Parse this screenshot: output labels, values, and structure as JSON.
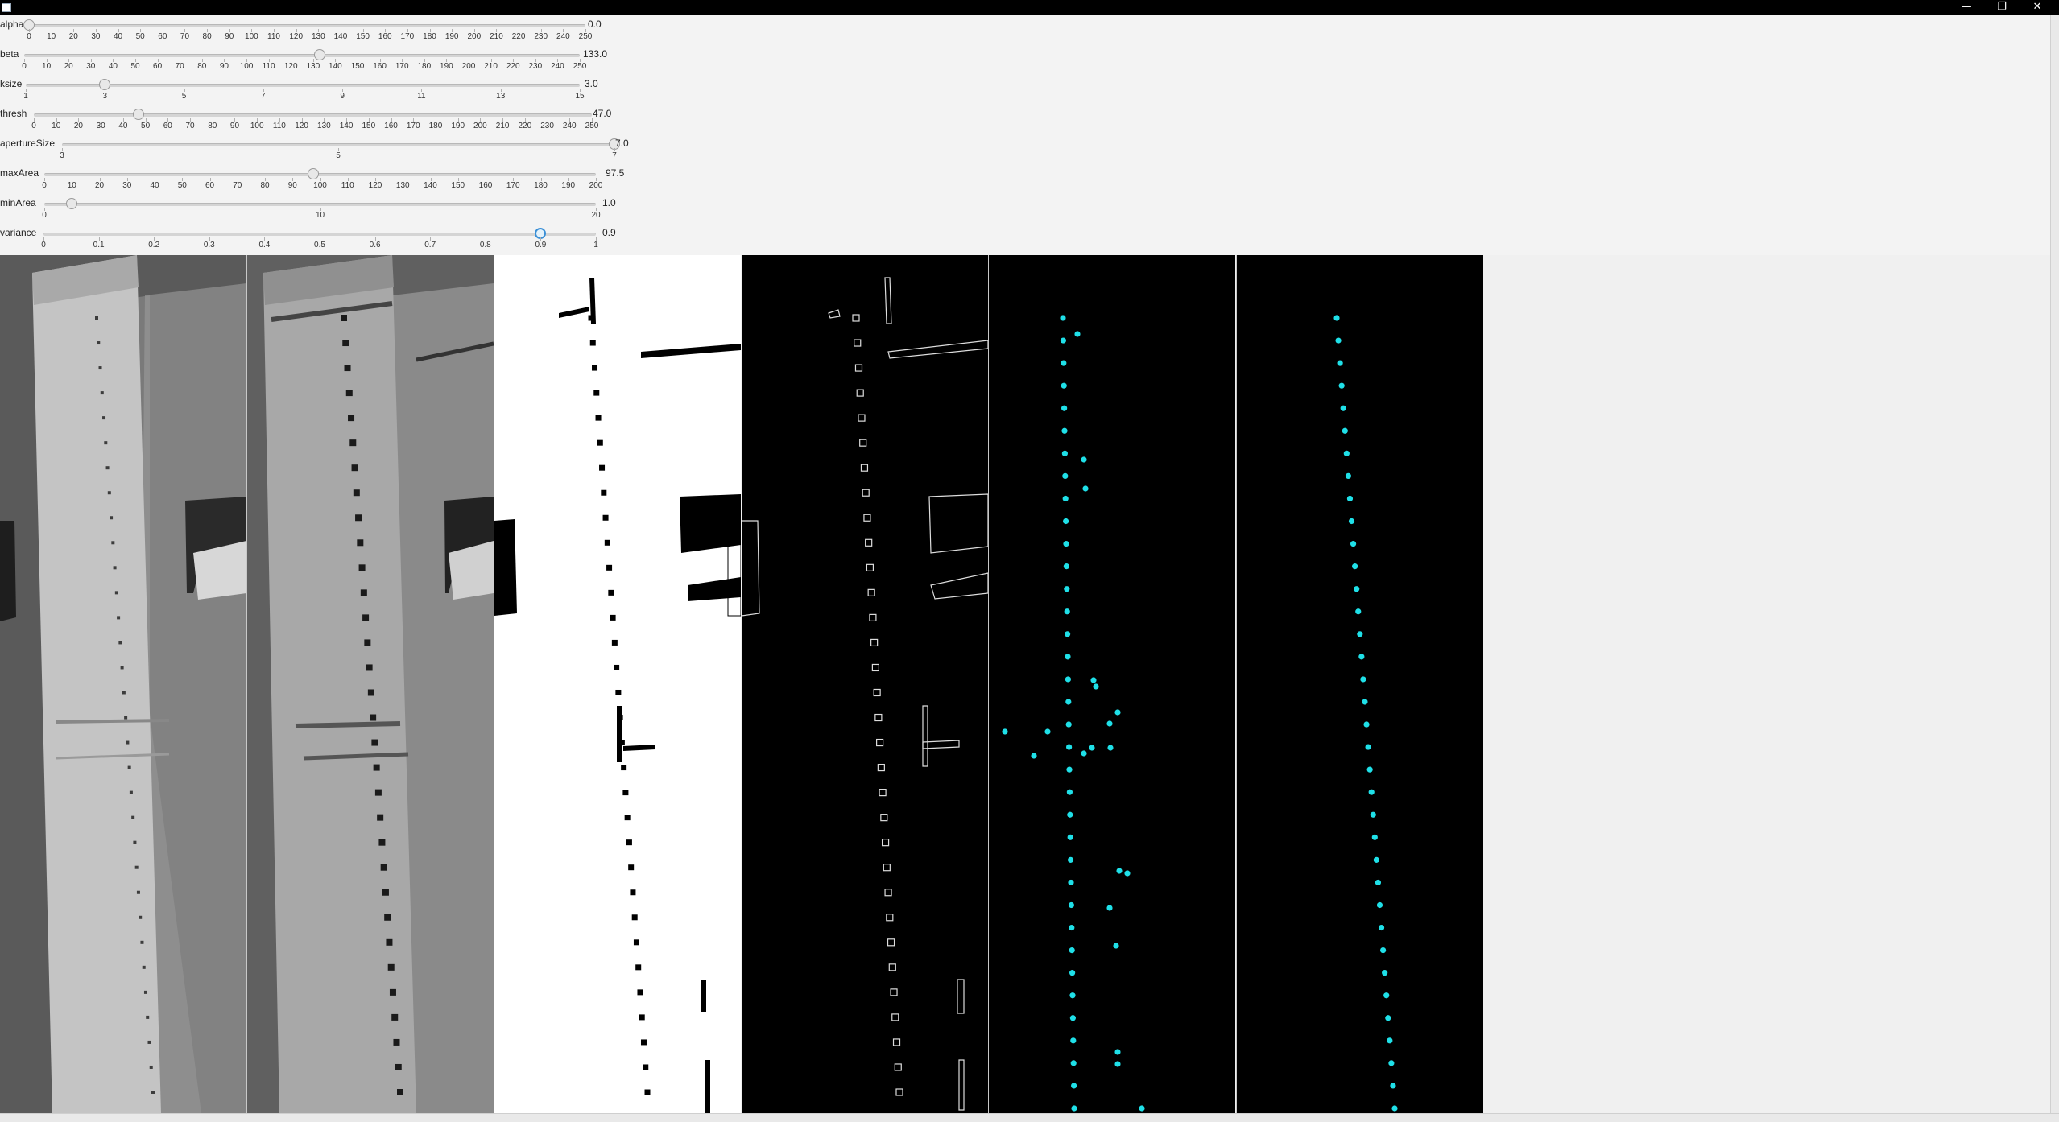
{
  "window": {
    "minimize_glyph": "—",
    "restore_glyph": "❐",
    "close_glyph": "✕"
  },
  "sliders": [
    {
      "id": "alpha",
      "label": "alpha",
      "value_text": "0.0",
      "min": 0,
      "max": 250,
      "value": 0,
      "tick_labels": [
        "0",
        "10",
        "20",
        "30",
        "40",
        "50",
        "60",
        "70",
        "80",
        "90",
        "100",
        "110",
        "120",
        "130",
        "140",
        "150",
        "160",
        "170",
        "180",
        "190",
        "200",
        "210",
        "220",
        "230",
        "240",
        "250"
      ]
    },
    {
      "id": "beta",
      "label": "beta",
      "value_text": "133.0",
      "min": 0,
      "max": 250,
      "value": 133,
      "tick_labels": [
        "0",
        "10",
        "20",
        "30",
        "40",
        "50",
        "60",
        "70",
        "80",
        "90",
        "100",
        "110",
        "120",
        "130",
        "140",
        "150",
        "160",
        "170",
        "180",
        "190",
        "200",
        "210",
        "220",
        "230",
        "240",
        "250"
      ]
    },
    {
      "id": "ksize",
      "label": "ksize",
      "value_text": "3.0",
      "min": 1,
      "max": 15,
      "value": 3,
      "tick_labels": [
        "1",
        "3",
        "5",
        "7",
        "9",
        "11",
        "13",
        "15"
      ]
    },
    {
      "id": "thresh",
      "label": "thresh",
      "value_text": "47.0",
      "min": 0,
      "max": 250,
      "value": 47,
      "tick_labels": [
        "0",
        "10",
        "20",
        "30",
        "40",
        "50",
        "60",
        "70",
        "80",
        "90",
        "100",
        "110",
        "120",
        "130",
        "140",
        "150",
        "160",
        "170",
        "180",
        "190",
        "200",
        "210",
        "220",
        "230",
        "240",
        "250"
      ]
    },
    {
      "id": "apertureSize",
      "label": "apertureSize",
      "value_text": "7.0",
      "min": 3,
      "max": 7,
      "value": 7,
      "tick_labels": [
        "3",
        "5",
        "7"
      ]
    },
    {
      "id": "maxArea",
      "label": "maxArea",
      "value_text": "97.5",
      "min": 0,
      "max": 200,
      "value": 97.5,
      "tick_labels": [
        "0",
        "10",
        "20",
        "30",
        "40",
        "50",
        "60",
        "70",
        "80",
        "90",
        "100",
        "110",
        "120",
        "130",
        "140",
        "150",
        "160",
        "170",
        "180",
        "190",
        "200"
      ]
    },
    {
      "id": "minArea",
      "label": "minArea",
      "value_text": "1.0",
      "min": 0,
      "max": 20,
      "value": 1,
      "tick_labels": [
        "0",
        "10",
        "20"
      ]
    },
    {
      "id": "variance",
      "label": "variance",
      "value_text": "0.9",
      "min": 0,
      "max": 1,
      "value": 0.9,
      "tick_labels": [
        "0",
        "0.1",
        "0.2",
        "0.3",
        "0.4",
        "0.5",
        "0.6",
        "0.7",
        "0.8",
        "0.9",
        "1"
      ]
    }
  ],
  "colors": {
    "marker": "#1fe0e8",
    "panel_black": "#000000",
    "panel_white": "#ffffff",
    "outline": "#dddddd"
  },
  "panels": [
    {
      "name": "grayscale-input-panel"
    },
    {
      "name": "contrast-adjusted-panel"
    },
    {
      "name": "threshold-panel"
    },
    {
      "name": "edge-contour-panel"
    },
    {
      "name": "all-blob-centers-panel"
    },
    {
      "name": "filtered-centers-panel"
    }
  ]
}
